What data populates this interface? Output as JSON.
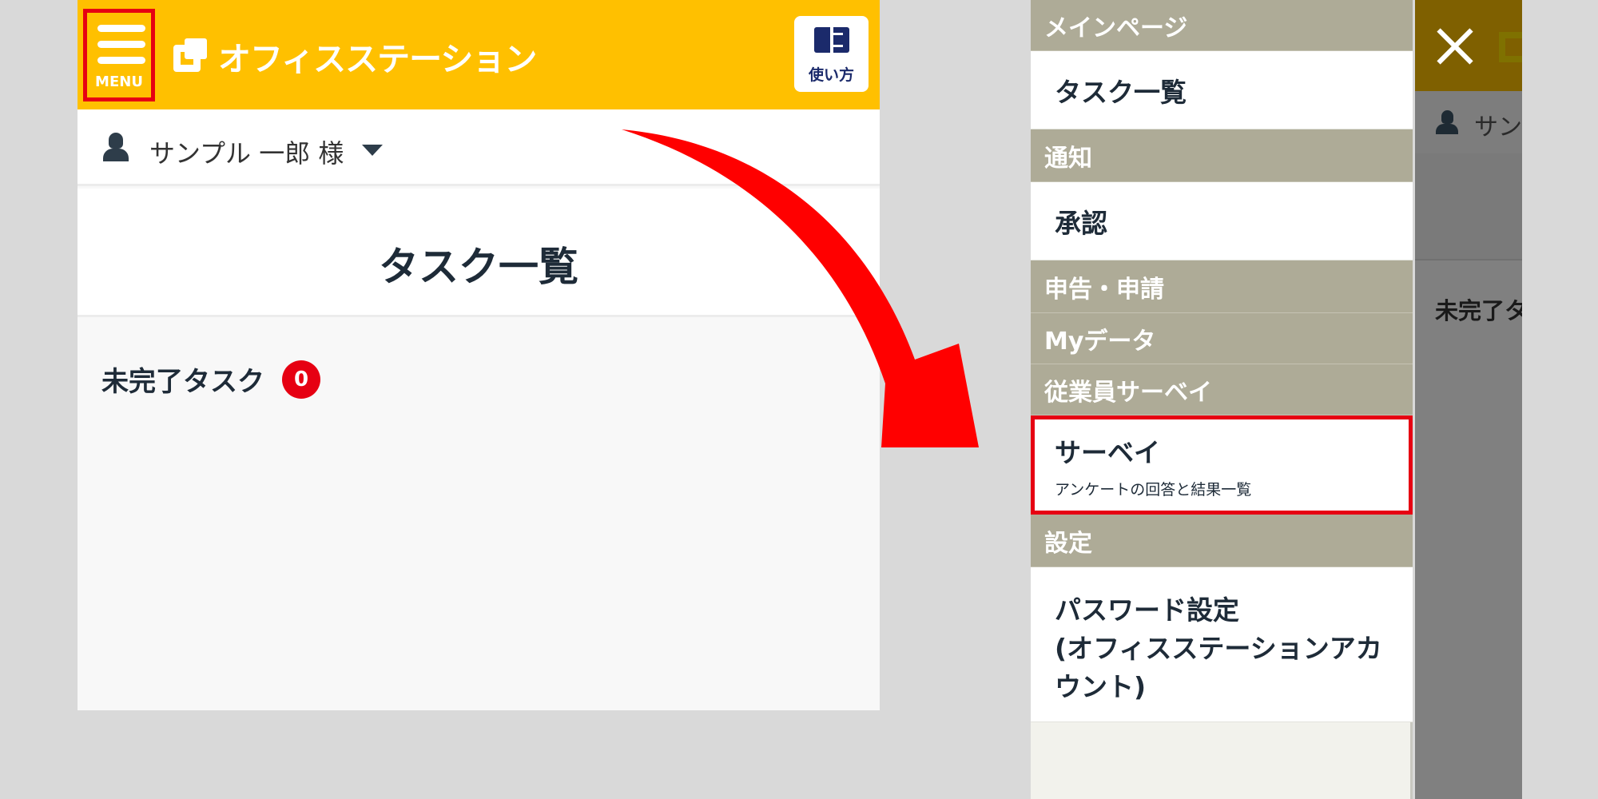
{
  "left_screen": {
    "header": {
      "menu_label": "MENU",
      "logo_text": "オフィスステーション",
      "howto_label": "使い方"
    },
    "user": {
      "name": "サンプル 一郎 様"
    },
    "page_title": "タスク一覧",
    "tasks": {
      "label": "未完了タスク",
      "count": "0"
    }
  },
  "right_screen": {
    "background": {
      "user_name_partial": "サンプ",
      "task_label_partial": "未完了タ"
    },
    "menu": {
      "main_section": "メインページ",
      "task_list": "タスク一覧",
      "notify_section": "通知",
      "approval": "承認",
      "apply_section": "申告・申請",
      "mydata_section": "Myデータ",
      "survey_section": "従業員サーベイ",
      "survey_item": "サーベイ",
      "survey_sub": "アンケートの回答と結果一覧",
      "settings_section": "設定",
      "password_line1": "パスワード設定",
      "password_line2": "(オフィスステーションアカ",
      "password_line3": "ウント)"
    }
  },
  "colors": {
    "header_yellow": "#ffc000",
    "highlight_red": "#e60012",
    "menu_section": "#aeab97",
    "text_dark": "#1e2b38"
  }
}
